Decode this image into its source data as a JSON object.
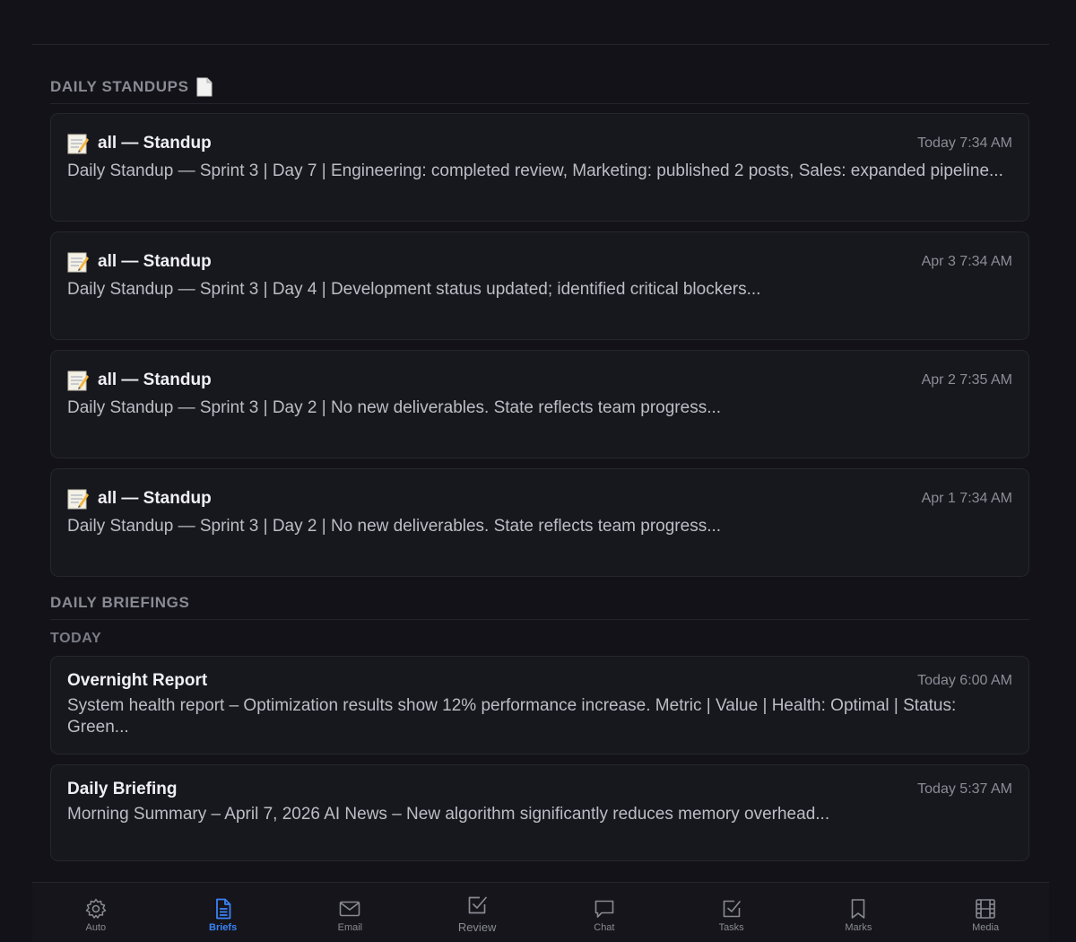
{
  "standups": {
    "heading": "DAILY STANDUPS",
    "items": [
      {
        "title": "all — Standup",
        "time": "Today 7:34 AM",
        "body": "Daily Standup — Sprint 3 | Day 7 | Engineering: completed review, Marketing: published 2 posts, Sales: expanded pipeline..."
      },
      {
        "title": "all — Standup",
        "time": "Apr 3 7:34 AM",
        "body": "Daily Standup — Sprint 3 | Day 4 | Development status updated; identified critical blockers..."
      },
      {
        "title": "all — Standup",
        "time": "Apr 2 7:35 AM",
        "body": "Daily Standup — Sprint 3 | Day 2 | No new deliverables. State reflects team progress..."
      },
      {
        "title": "all — Standup",
        "time": "Apr 1 7:34 AM",
        "body": "Daily Standup — Sprint 3 | Day 2 | No new deliverables. State reflects team progress..."
      }
    ]
  },
  "briefings": {
    "heading": "DAILY BRIEFINGS",
    "group_label": "TODAY",
    "items": [
      {
        "title": "Overnight Report",
        "time": "Today 6:00 AM",
        "body": "System health report – Optimization results show 12% performance increase. Metric | Value | Health: Optimal | Status: Green..."
      },
      {
        "title": "Daily Briefing",
        "time": "Today 5:37 AM",
        "body": "Morning Summary – April 7, 2026 AI News – New algorithm significantly reduces memory overhead..."
      }
    ]
  },
  "nav": {
    "active": "Briefs",
    "accent": "#3b82f6",
    "items": [
      {
        "label": "Auto",
        "icon": "gear-icon"
      },
      {
        "label": "Briefs",
        "icon": "document-icon"
      },
      {
        "label": "Email",
        "icon": "envelope-icon"
      },
      {
        "label": "Review",
        "icon": "checkbox-icon"
      },
      {
        "label": "Chat",
        "icon": "chat-bubble-icon"
      },
      {
        "label": "Tasks",
        "icon": "task-check-icon"
      },
      {
        "label": "Marks",
        "icon": "bookmark-icon"
      },
      {
        "label": "Media",
        "icon": "film-grid-icon"
      }
    ]
  }
}
